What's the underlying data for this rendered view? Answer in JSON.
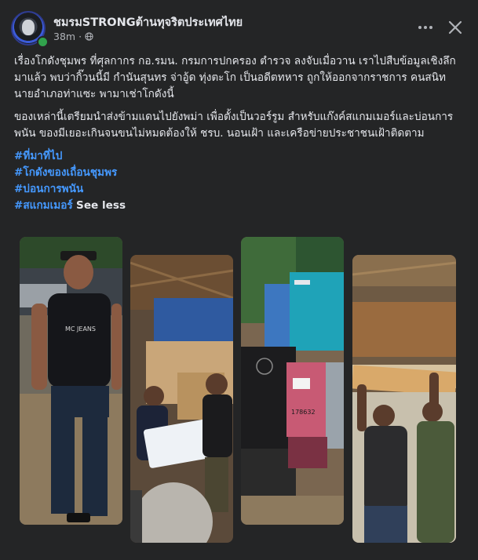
{
  "post": {
    "page_name": "ชมรมSTRONGต้านทุจริตประเทศไทย",
    "time": "38m",
    "dot": "·",
    "paragraphs": [
      "เรื่องโกดังชุมพร ที่ศุลกากร กอ.รมน. กรมการปกครอง ตำรวจ ลงจับเมื่อวาน เราไปสืบข้อมูลเชิงลึกมาแล้ว พบว่ากิ๊วนนี้มี กำนันสุนทร จ่าอู้ด ทุ่งตะโก เป็นอดีตทหาร ถูกให้ออกจากราชการ คนสนิทนายอำเภอท่าแซะ พามาเช่าโกดังนี้",
      "ของเหล่านี้เตรียมนำส่งข้ามแดนไปยังพม่า เพื่อตั้งเป็นวอร์รูม สำหรับแก๊งค์สแกมเมอร์และบ่อนการพนัน ของมีเยอะเกินจนขนไม่หมดต้องให้ ชรบ. นอนเฝ้า และเครือข่ายประชาชนเฝ้าติดตาม"
    ],
    "hashtags": [
      "#ที่มาที่ไป",
      "#โกดังของเถื่อนชุมพร",
      "#บ่อนการพนัน",
      "#สแกมเมอร์"
    ],
    "see_less": "See less"
  },
  "photos": [
    {
      "name": "photo-man-black-shirt",
      "shirt_text": "MC JEANS"
    },
    {
      "name": "photo-officers-boxes"
    },
    {
      "name": "photo-generators",
      "machine_number": "178632"
    },
    {
      "name": "photo-soldier-carrying-box"
    }
  ],
  "icons": {
    "more": "more-options-icon",
    "close": "close-icon",
    "privacy": "globe-icon"
  },
  "colors": {
    "background": "#242526",
    "hashtag": "#4599ff",
    "online": "#31a24c"
  }
}
